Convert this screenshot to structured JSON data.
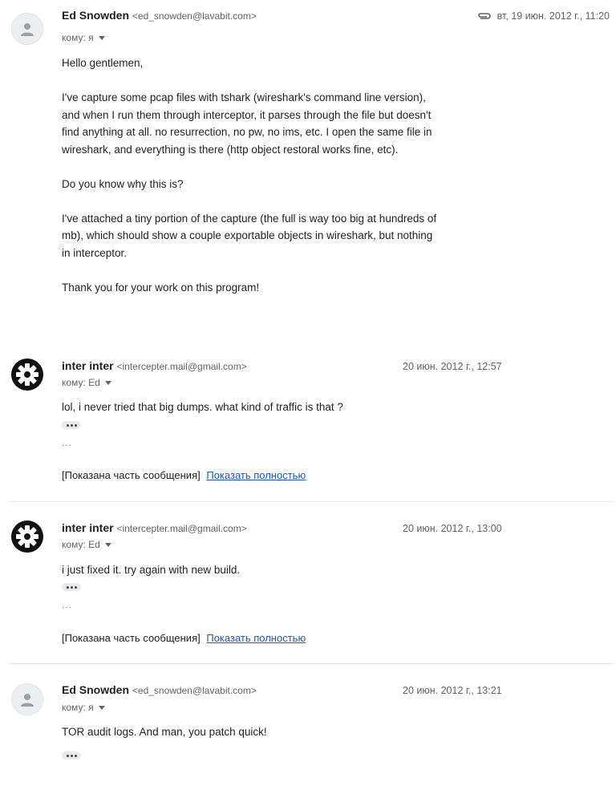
{
  "messages": [
    {
      "sender_name": "Ed Snowden",
      "sender_email": "<ed_snowden@lavabit.com>",
      "to_label": "кому: я",
      "date": "вт, 19 июн. 2012 г., 11:20",
      "has_attachment": true,
      "avatar": "person-icon",
      "body": [
        "Hello gentlemen,",
        "I've capture some pcap files with tshark (wireshark's command line version), and when I run them through interceptor, it parses through the file but doesn't find anything at all.  no resurrection, no pw, no ims, etc.  I open the same file in wireshark, and everything is there (http object restoral works fine, etc).",
        "Do you know why this is?",
        "I've attached a tiny portion of the capture (the full is way too big at hundreds of mb), which should show  a couple exportable objects in wireshark, but nothing in interceptor.",
        "Thank you for your work on this program!"
      ]
    },
    {
      "sender_name": "inter inter",
      "sender_email": "<intercepter.mail@gmail.com>",
      "to_label": "кому: Ed",
      "date": "20 июн. 2012 г., 12:57",
      "avatar": "gear-icon",
      "snippet": "lol, i never tried that big dumps.  what kind of traffic is that ?",
      "ellipsis": "...",
      "truncated_note": "[Показана часть сообщения]",
      "show_full_link": "Показать полностью"
    },
    {
      "sender_name": "inter inter",
      "sender_email": "<intercepter.mail@gmail.com>",
      "to_label": "кому: Ed",
      "date": "20 июн. 2012 г., 13:00",
      "avatar": "gear-icon",
      "snippet": "i just fixed it. try again with new build.",
      "ellipsis": "...",
      "truncated_note": "[Показана часть сообщения]",
      "show_full_link": "Показать полностью"
    },
    {
      "sender_name": "Ed Snowden",
      "sender_email": "<ed_snowden@lavabit.com>",
      "to_label": "кому: я",
      "date": "20 июн. 2012 г., 13:21",
      "avatar": "person-icon",
      "snippet": "TOR audit logs.  And man, you patch quick!"
    }
  ],
  "colors": {
    "link": "#1a55c7",
    "secondary_text": "#5f6368",
    "divider": "#e6e6e6"
  }
}
